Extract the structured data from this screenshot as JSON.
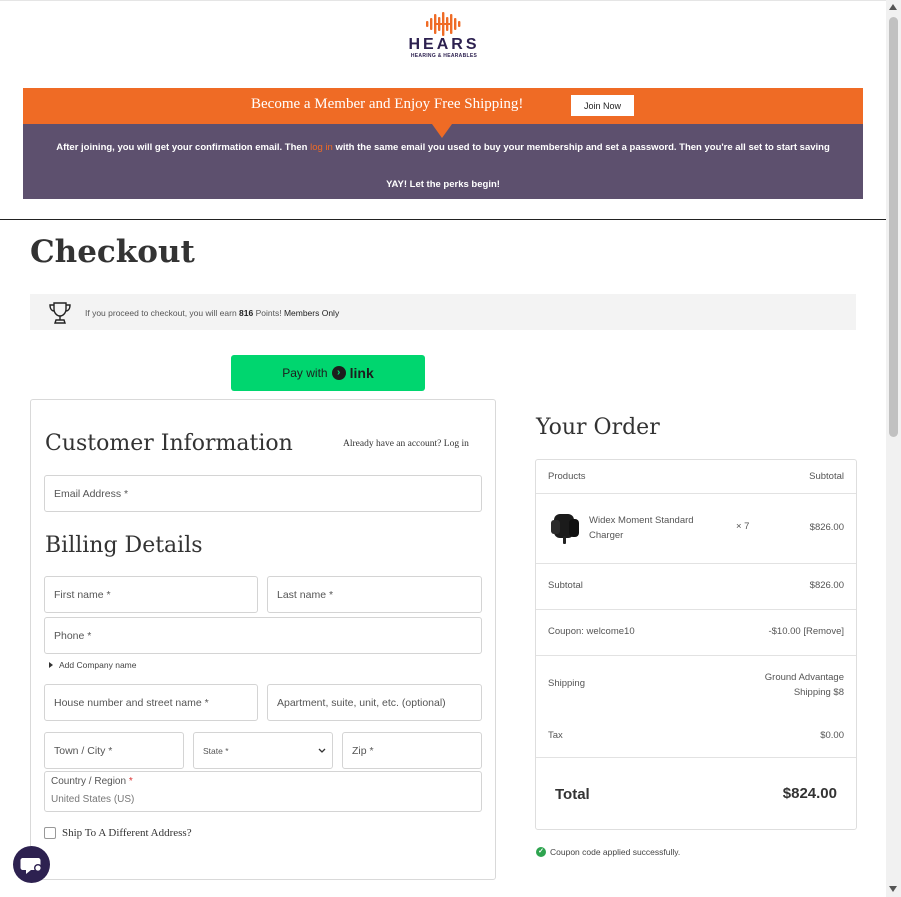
{
  "brand": {
    "name": "HEARS",
    "tagline": "HEARING & HEARABLES",
    "color_orange": "#ef6b25",
    "color_purple": "#5d506e",
    "color_navy": "#2d2150"
  },
  "promo": {
    "headline": "Become a Member and Enjoy Free Shipping!",
    "join_button": "Join Now",
    "info_before": "After joining, you will get your confirmation email.  Then ",
    "info_link": "log in",
    "info_after": " with the same email you used to buy your membership and set a password. Then you're all set to start saving",
    "perks": "YAY! Let the perks begin!"
  },
  "checkout": {
    "title": "Checkout",
    "points_before": "If you proceed to checkout, you will earn ",
    "points_value": "816",
    "points_after": " Points! ",
    "points_members": "Members Only",
    "pay_with": "Pay with",
    "pay_brand": "link"
  },
  "customer": {
    "title": "Customer Information",
    "account_prompt": "Already have an account? ",
    "login_link": "Log in",
    "email_placeholder": "Email Address *"
  },
  "billing": {
    "title": "Billing Details",
    "first_name": "First name *",
    "last_name": "Last name *",
    "phone": "Phone *",
    "add_company": "Add Company name",
    "street": "House number and street name *",
    "apartment": "Apartment, suite, unit, etc. (optional)",
    "city": "Town / City *",
    "state": "State *",
    "zip": "Zip *",
    "country_label": "Country / Region ",
    "country_required": "*",
    "country_value": "United States (US)",
    "ship_different": "Ship To A Different Address?"
  },
  "order": {
    "title": "Your Order",
    "col_products": "Products",
    "col_subtotal": "Subtotal",
    "items": [
      {
        "name": "Widex Moment Standard Charger",
        "qty": "× 7",
        "price": "$826.00"
      }
    ],
    "subtotal_label": "Subtotal",
    "subtotal_value": "$826.00",
    "coupon_label": "Coupon: welcome10",
    "coupon_value": "-$10.00",
    "coupon_remove": "[Remove]",
    "shipping_label": "Shipping",
    "shipping_value_1": "Ground Advantage",
    "shipping_value_2": "Shipping $8",
    "tax_label": "Tax",
    "tax_value": "$0.00",
    "total_label": "Total",
    "total_value": "$824.00",
    "coupon_message": "Coupon code applied successfully."
  },
  "icons": {
    "logo": "sound-wave-logo-icon",
    "trophy": "trophy-icon",
    "chat": "chat-icon",
    "check": "check-circle-icon",
    "chevron": "chevron-down-icon"
  }
}
